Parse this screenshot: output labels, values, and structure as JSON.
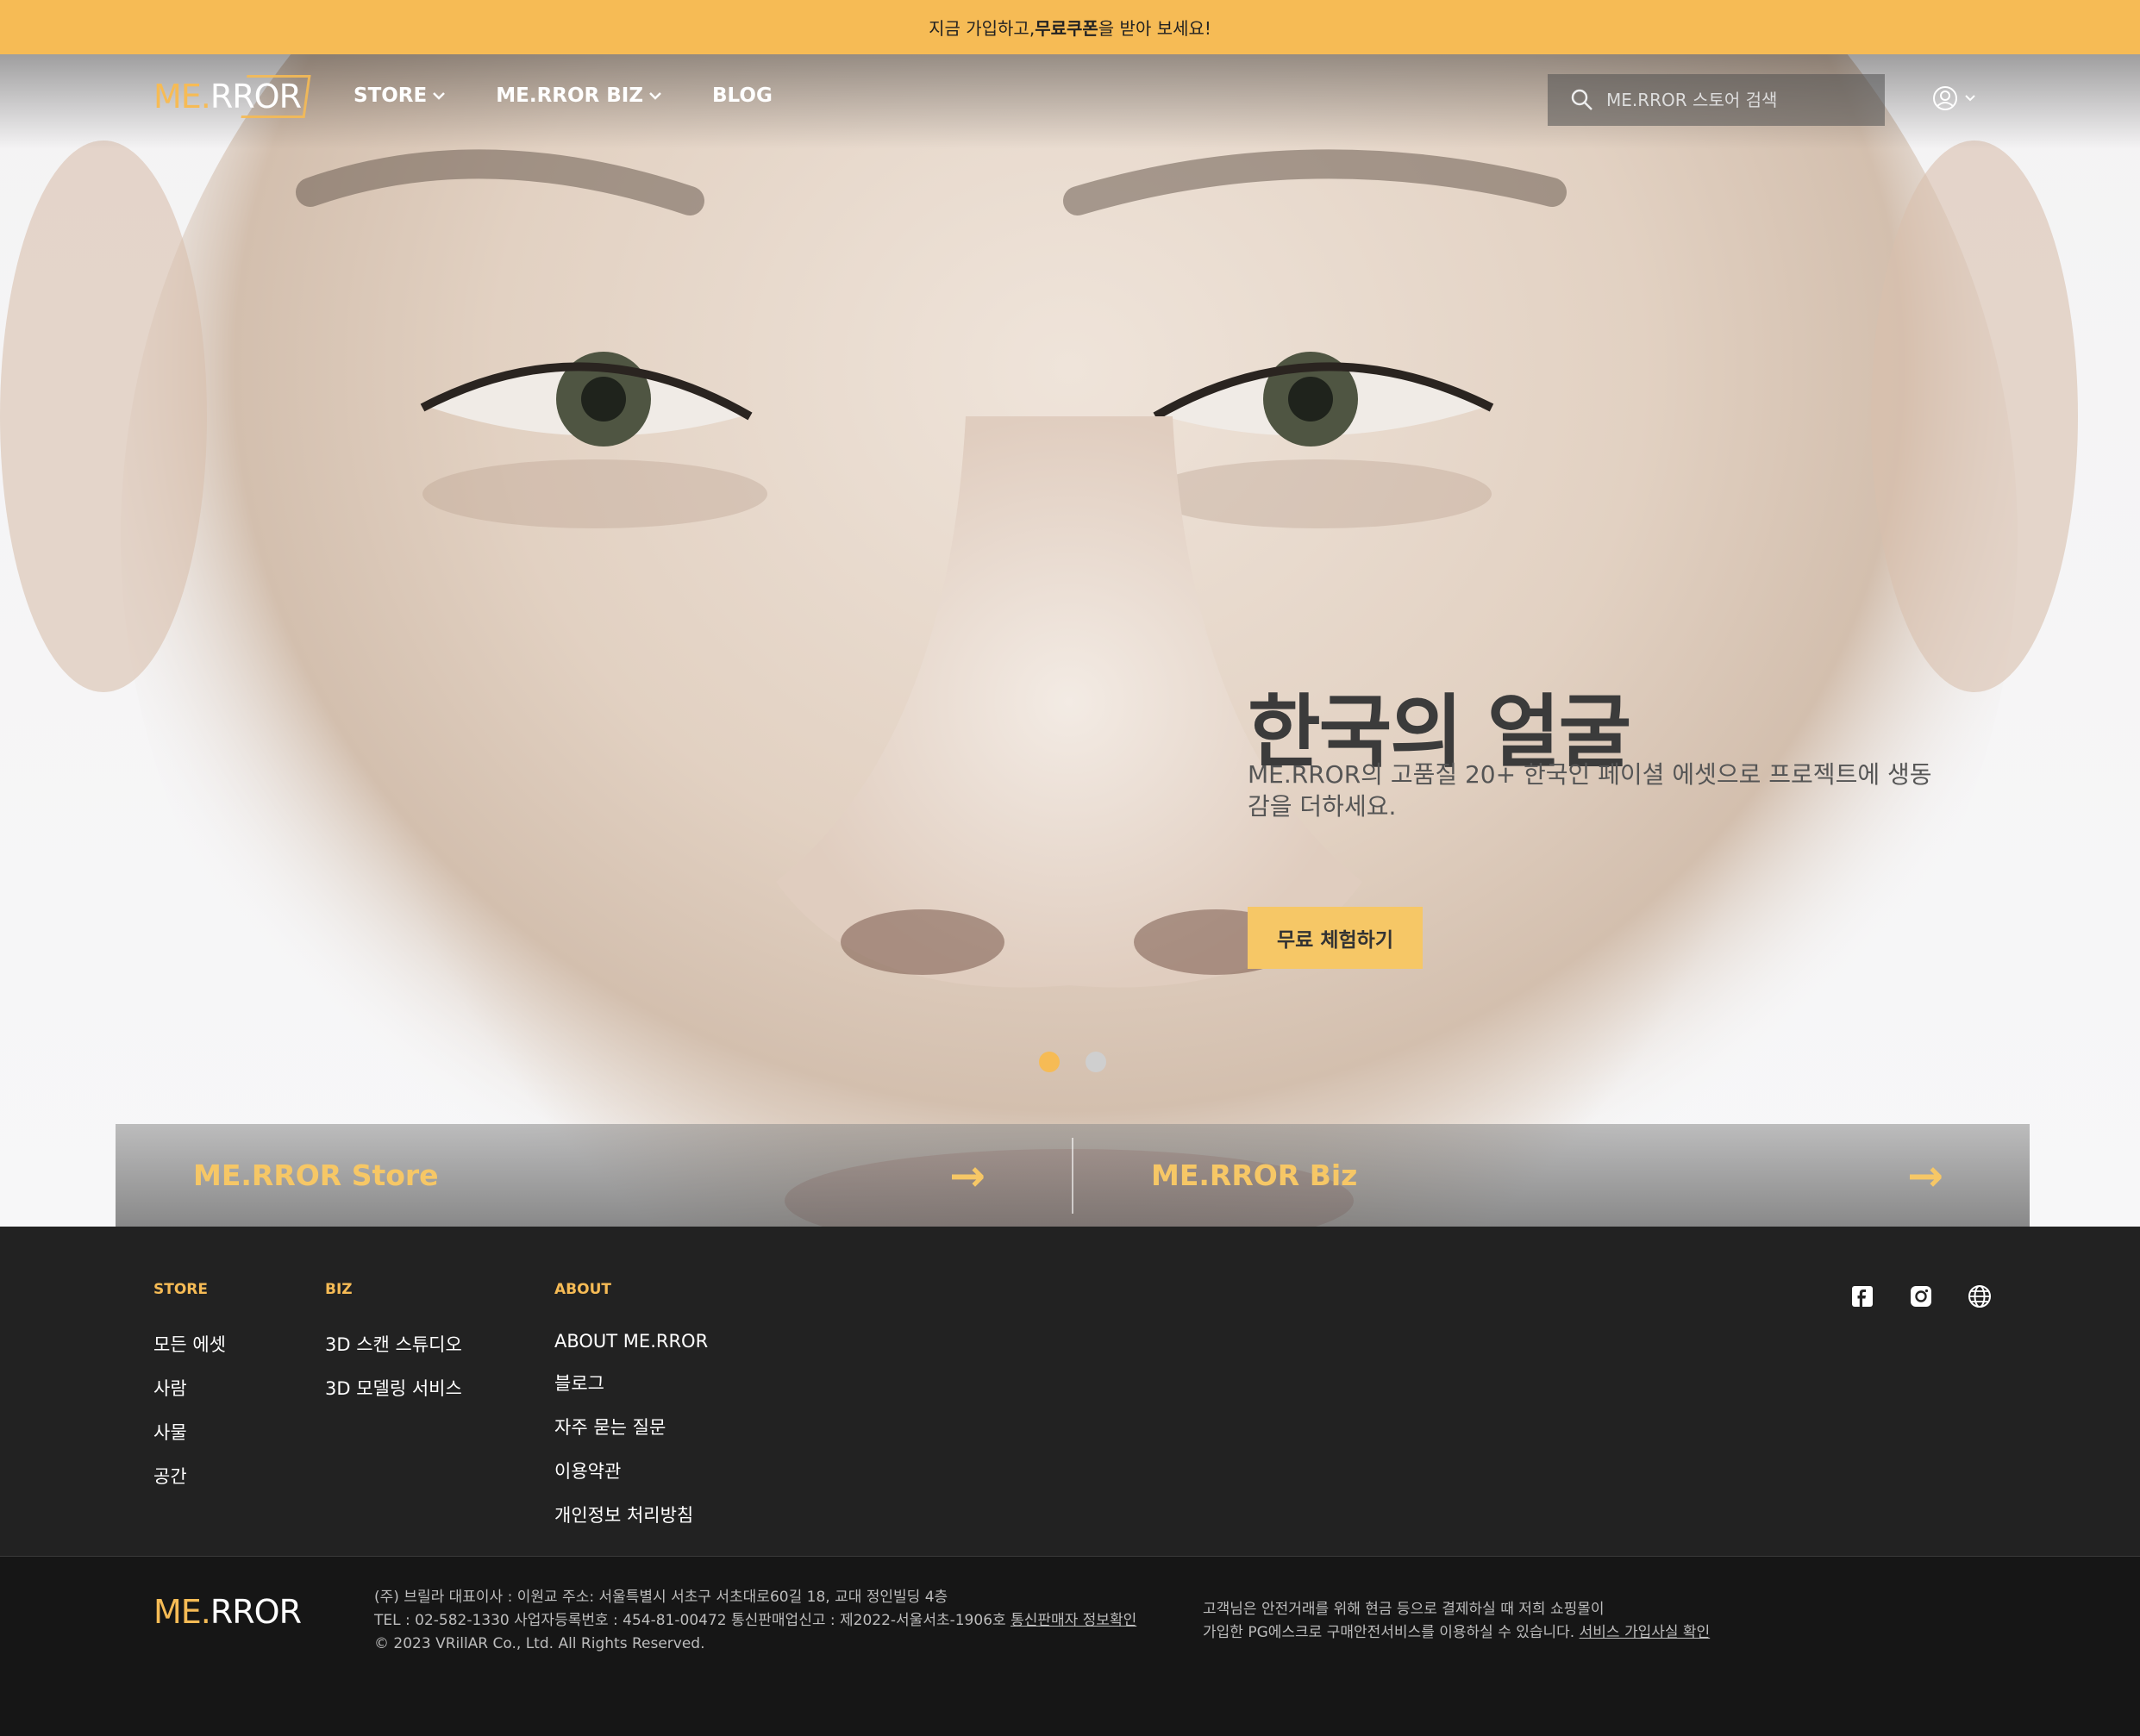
{
  "promo": {
    "prefix": "지금 가입하고, ",
    "bold": "무료쿠폰",
    "suffix": "을 받아 보세요!"
  },
  "brand": {
    "me": "ME.",
    "rror": "RROR"
  },
  "nav": {
    "items": [
      {
        "label": "STORE",
        "has_dropdown": true
      },
      {
        "label": "ME.RROR BIZ",
        "has_dropdown": true
      },
      {
        "label": "BLOG",
        "has_dropdown": false
      }
    ],
    "search_placeholder": "ME.RROR 스토어 검색"
  },
  "hero": {
    "title": "한국의 얼굴",
    "subtitle": "ME.RROR의 고품질 20+ 한국인 페이셜 에셋으로 프로젝트에 생동감을 더하세요.",
    "cta": "무료 체험하기",
    "slides": 2,
    "active_slide": 1
  },
  "linkbar": {
    "store": "ME.RROR Store",
    "biz": "ME.RROR Biz",
    "arrow": "→"
  },
  "footer": {
    "columns": [
      {
        "heading": "STORE",
        "links": [
          "모든 에셋",
          "사람",
          "사물",
          "공간"
        ]
      },
      {
        "heading": "BIZ",
        "links": [
          "3D 스캔 스튜디오",
          "3D 모델링 서비스"
        ]
      },
      {
        "heading": "ABOUT",
        "links": [
          "ABOUT ME.RROR",
          "블로그",
          "자주 묻는 질문",
          "이용약관",
          "개인정보 처리방침"
        ]
      }
    ],
    "social": [
      "facebook-icon",
      "instagram-icon",
      "globe-icon"
    ]
  },
  "company": {
    "line1": "(주) 브릴라    대표이사 : 이원교    주소: 서울특별시 서초구 서초대로60길 18, 교대 정인빌딩 4층",
    "line2": "TEL : 02-582-1330    사업자등록번호 : 454-81-00472    통신판매업신고 : 제2022-서울서초-1906호   ",
    "line2_link": "통신판매자 정보확인",
    "line3": "© 2023 VRillAR Co., Ltd. All Rights Reserved.",
    "escrow1": "고객님은 안전거래를 위해 현금 등으로 결제하실 때 저희 쇼핑몰이",
    "escrow2": "가입한 PG에스크로 구매안전서비스를 이용하실 수 있습니다.   ",
    "escrow_link": "서비스 가입사실 확인"
  },
  "colors": {
    "accent": "#f6bb55",
    "footer_bg": "#222222",
    "bottom_bg": "#161616"
  }
}
